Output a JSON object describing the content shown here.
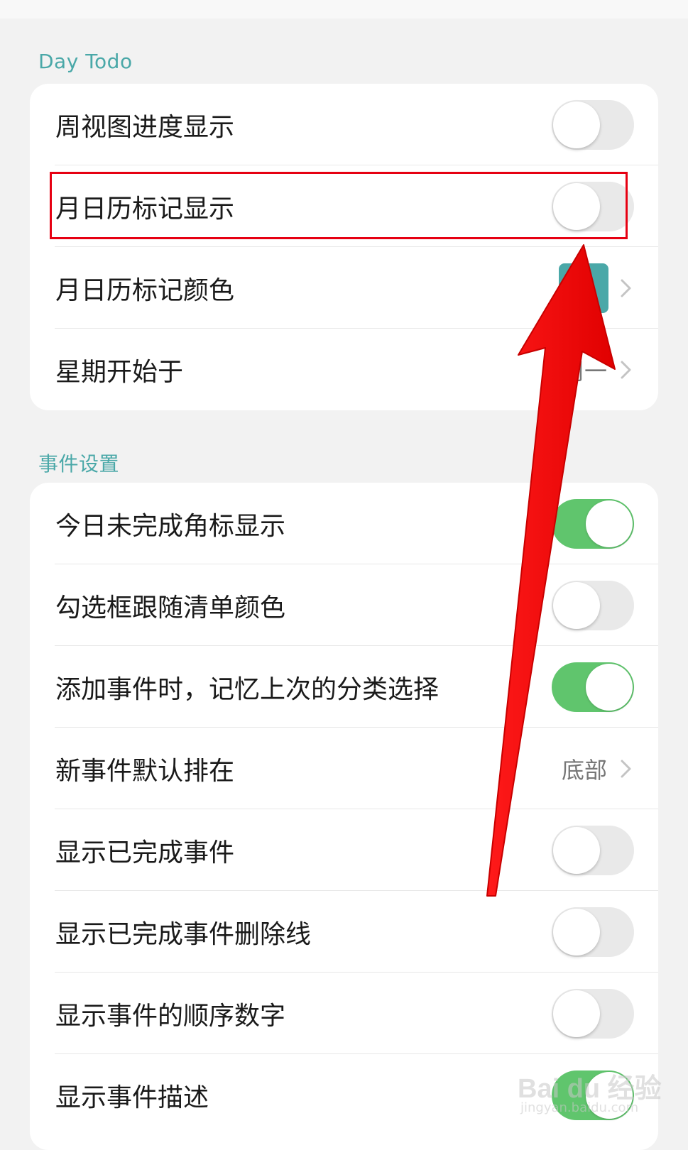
{
  "sections": [
    {
      "title": "Day Todo",
      "rows": [
        {
          "label": "周视图进度显示",
          "control": "toggle",
          "on": false
        },
        {
          "label": "月日历标记显示",
          "control": "toggle",
          "on": false,
          "highlighted": true
        },
        {
          "label": "月日历标记颜色",
          "control": "color",
          "color": "#4aa8a8"
        },
        {
          "label": "星期开始于",
          "control": "value",
          "value": "周一"
        }
      ]
    },
    {
      "title": "事件设置",
      "rows": [
        {
          "label": "今日未完成角标显示",
          "control": "toggle",
          "on": true
        },
        {
          "label": "勾选框跟随清单颜色",
          "control": "toggle",
          "on": false
        },
        {
          "label": "添加事件时，记忆上次的分类选择",
          "control": "toggle",
          "on": true
        },
        {
          "label": "新事件默认排在",
          "control": "value",
          "value": "底部"
        },
        {
          "label": "显示已完成事件",
          "control": "toggle",
          "on": false
        },
        {
          "label": "显示已完成事件删除线",
          "control": "toggle",
          "on": false
        },
        {
          "label": "显示事件的顺序数字",
          "control": "toggle",
          "on": false
        },
        {
          "label": "显示事件描述",
          "control": "toggle",
          "on": true
        }
      ]
    }
  ],
  "colors": {
    "accent": "#4aa8a8",
    "toggle_on": "#60c56d",
    "toggle_off": "#e9e9e9",
    "annotation": "#e60012"
  },
  "watermark": {
    "main": "Bai du 经验",
    "sub": "jingyan.baidu.com"
  }
}
